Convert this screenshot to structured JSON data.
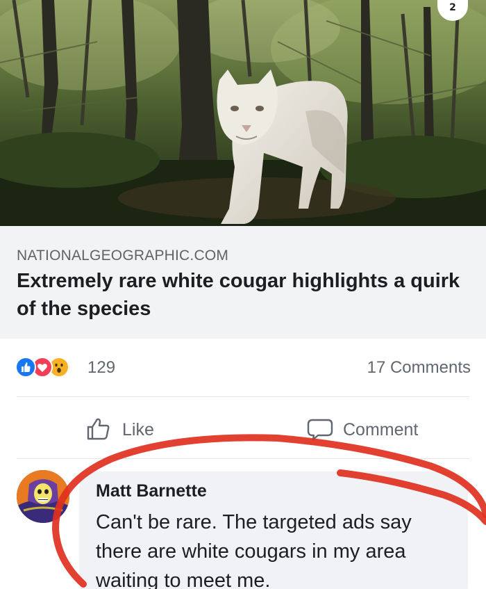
{
  "page_badge": "2",
  "photo": {
    "subject": "white cougar walking in forest",
    "colors": {
      "forest_dark": "#1f2a17",
      "forest_mid": "#3e5228",
      "forest_light": "#7d8f4a",
      "cougar": "#e6e2da"
    }
  },
  "link_preview": {
    "domain": "NATIONALGEOGRAPHIC.COM",
    "headline": "Extremely rare white cougar highlights a quirk of the species"
  },
  "reactions": {
    "icons": [
      "like-reaction-icon",
      "love-reaction-icon",
      "wow-reaction-icon"
    ],
    "count": "129",
    "comments_count": "17 Comments"
  },
  "actions": {
    "like_label": "Like",
    "comment_label": "Comment"
  },
  "comment": {
    "author": "Matt Barnette",
    "text": "Can't be rare. The targeted ads say there are white cougars in my area waiting to meet me."
  },
  "colors": {
    "accent_like": "#1877f2",
    "love": "#f33e58",
    "wow": "#f7b125",
    "annotation_red": "#e0301e"
  }
}
